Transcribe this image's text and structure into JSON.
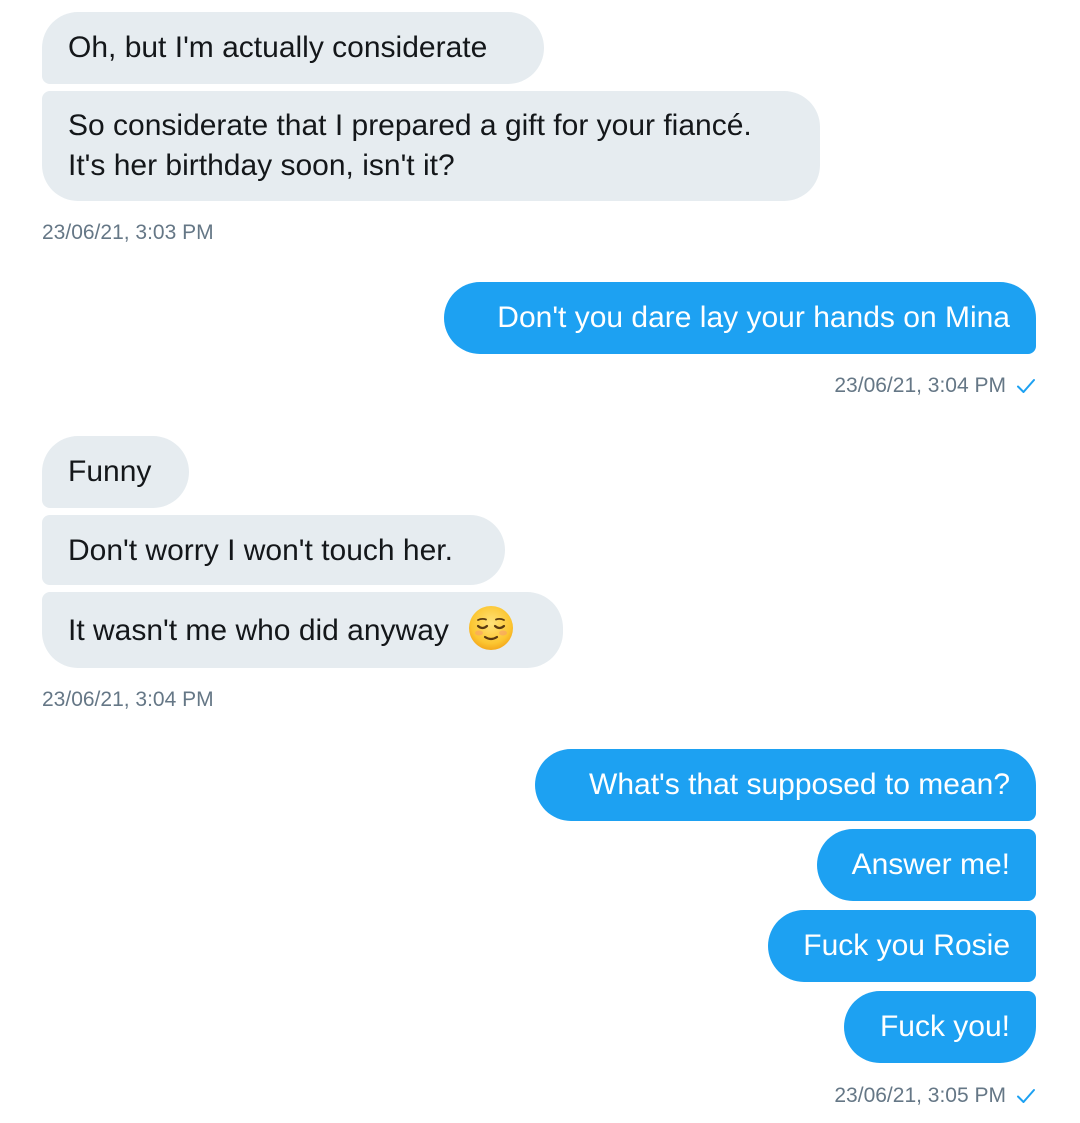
{
  "conversation": {
    "group1": {
      "messages": [
        "Oh, but I'm actually considerate",
        "So considerate that I prepared a gift for your fiancé.",
        "It's her birthday soon, isn't it?"
      ],
      "timestamp": "23/06/21, 3:03 PM"
    },
    "group2": {
      "messages": [
        "Don't you dare lay your hands on Mina"
      ],
      "timestamp": "23/06/21, 3:04 PM",
      "status_icon": "check-icon"
    },
    "group3": {
      "messages": [
        "Funny",
        "Don't worry I won't touch her.",
        "It wasn't me who did anyway"
      ],
      "emoji": "relieved-face-icon",
      "timestamp": "23/06/21, 3:04 PM"
    },
    "group4": {
      "messages": [
        "What's that supposed to mean?",
        "Answer me!",
        "Fuck you Rosie",
        "Fuck you!"
      ],
      "timestamp": "23/06/21, 3:05 PM",
      "status_icon": "check-icon"
    }
  },
  "colors": {
    "incoming_bubble": "#e6ecf0",
    "outgoing_bubble": "#1da1f2",
    "timestamp_text": "#657786",
    "check": "#1da1f2"
  }
}
